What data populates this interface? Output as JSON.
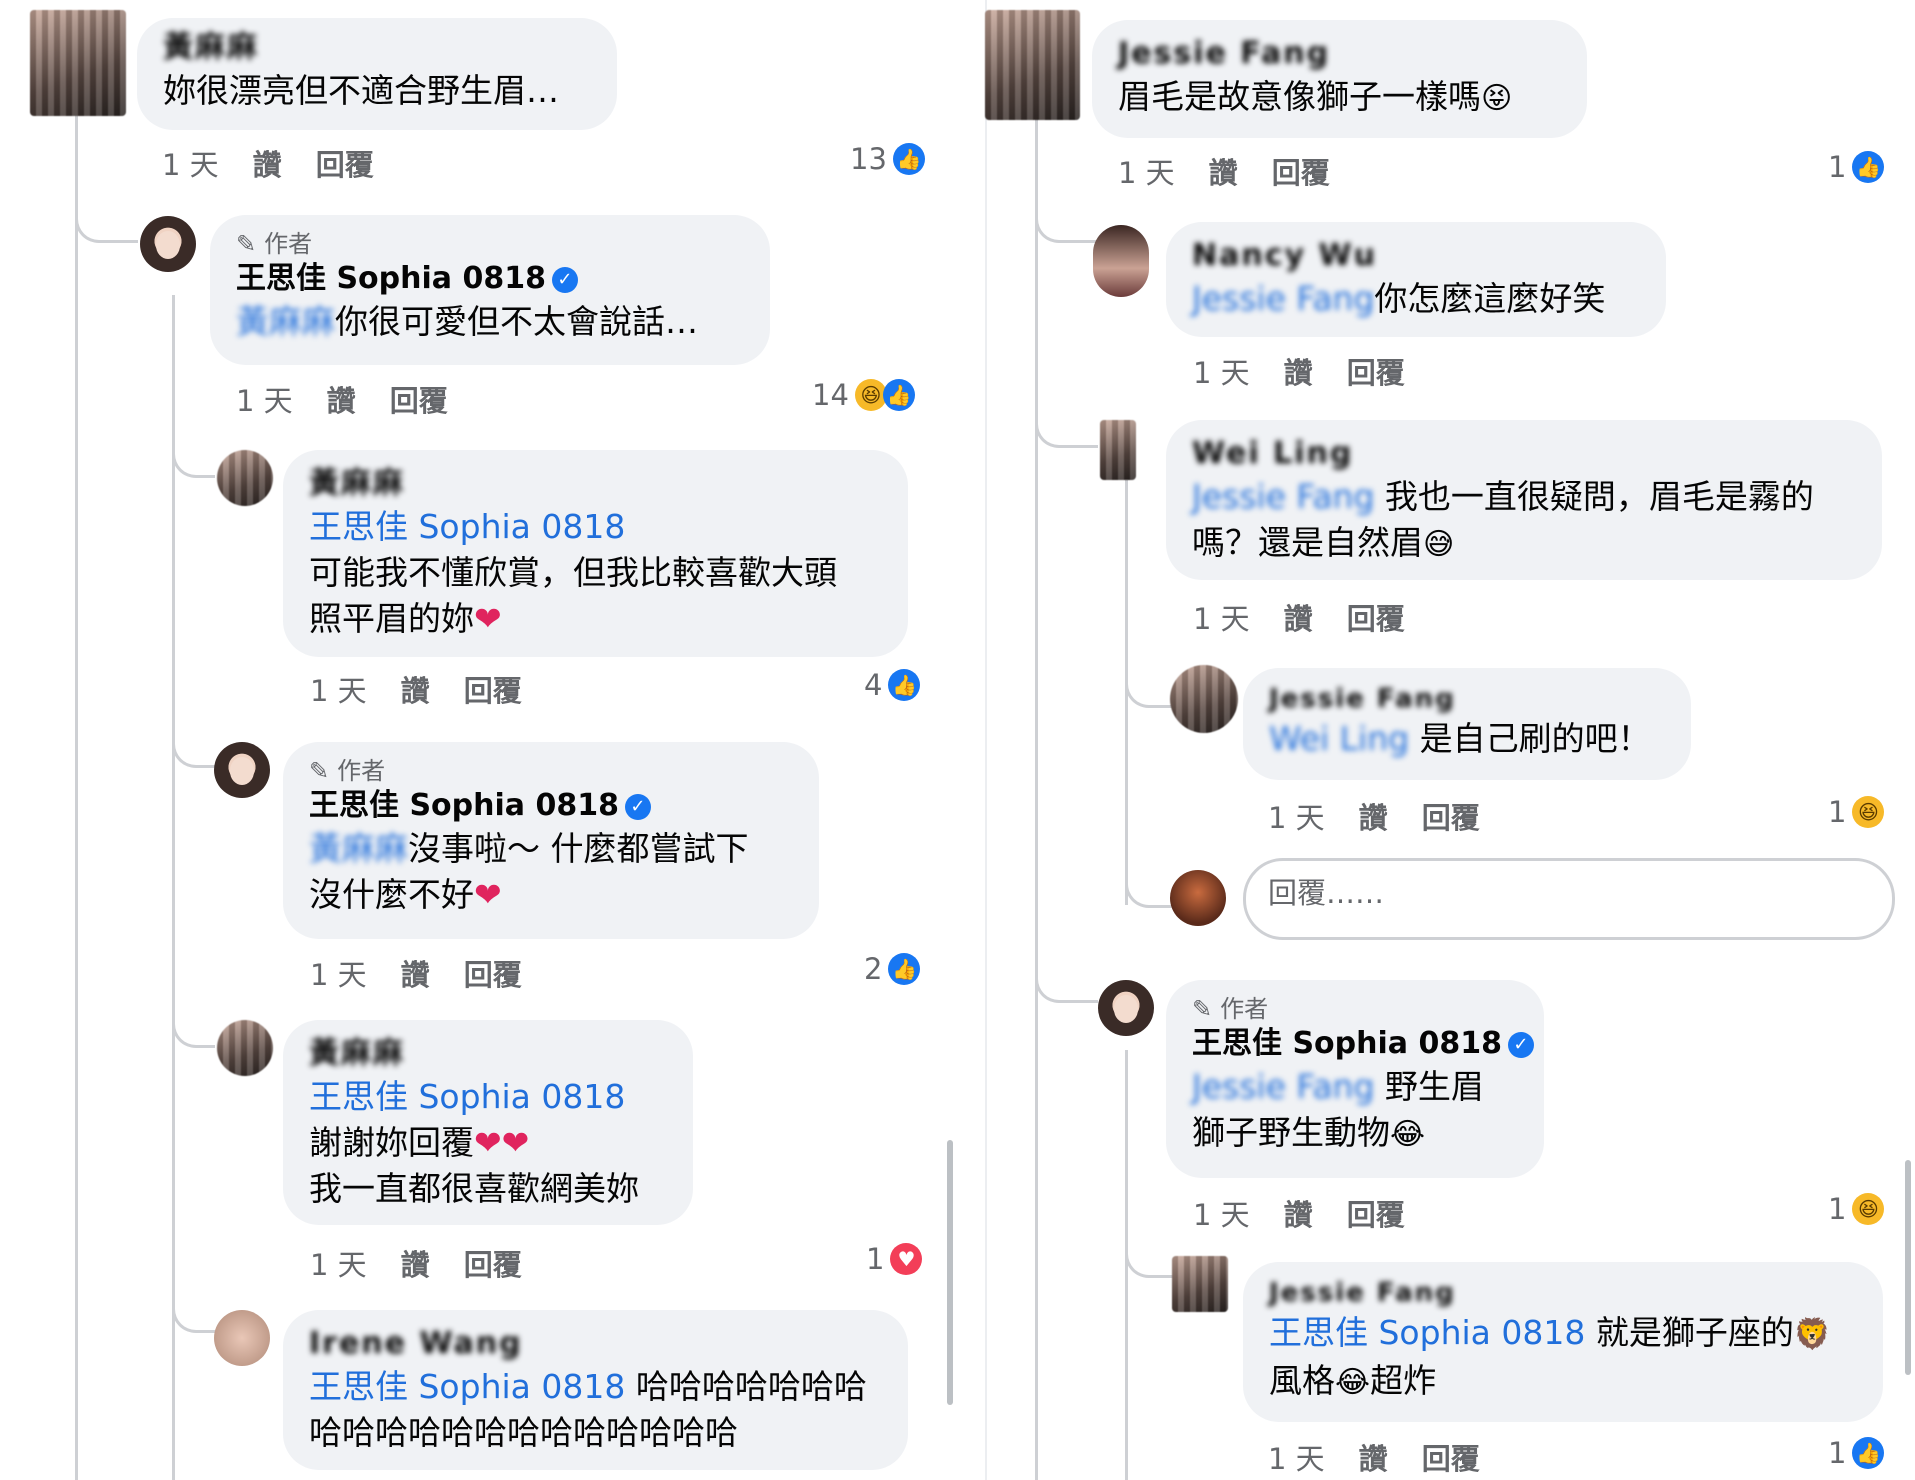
{
  "left": {
    "c1": {
      "name": "黃麻麻",
      "text": "妳很漂亮但不適合野生眉…",
      "time": "1 天",
      "like": "讚",
      "reply": "回覆",
      "count": "13"
    },
    "c2": {
      "author": "作者",
      "name": "王思佳 Sophia 0818",
      "mention": "黃麻麻",
      "text": "你很可愛但不太會說話…",
      "time": "1 天",
      "like": "讚",
      "reply": "回覆",
      "count": "14"
    },
    "c3": {
      "name": "黃麻麻",
      "mention": "王思佳 Sophia 0818",
      "text1": "可能我不懂欣賞，但我比較喜歡大頭",
      "text2": "照平眉的妳",
      "time": "1 天",
      "like": "讚",
      "reply": "回覆",
      "count": "4"
    },
    "c4": {
      "author": "作者",
      "name": "王思佳 Sophia 0818",
      "mention": "黃麻麻",
      "text1": "沒事啦～ 什麼都嘗試下",
      "text2": "沒什麼不好",
      "time": "1 天",
      "like": "讚",
      "reply": "回覆",
      "count": "2"
    },
    "c5": {
      "name": "黃麻麻",
      "mention": "王思佳 Sophia 0818",
      "text1": "謝謝妳回覆",
      "text2": "我一直都很喜歡網美妳",
      "time": "1 天",
      "like": "讚",
      "reply": "回覆",
      "count": "1"
    },
    "c6": {
      "name": "Irene Wang",
      "mention": "王思佳 Sophia 0818",
      "text1": "哈哈哈哈哈哈哈",
      "text2": "哈哈哈哈哈哈哈哈哈哈哈哈哈"
    }
  },
  "right": {
    "c1": {
      "name": "Jessie Fang",
      "text": "眉毛是故意像獅子一樣嗎",
      "time": "1 天",
      "like": "讚",
      "reply": "回覆",
      "count": "1"
    },
    "c2": {
      "name": "Nancy Wu",
      "mention": "Jessie Fang",
      "text": "你怎麼這麼好笑",
      "time": "1 天",
      "like": "讚",
      "reply": "回覆"
    },
    "c3": {
      "name": "Wei Ling",
      "mention": "Jessie Fang",
      "text1": "我也一直很疑問，眉毛是霧的",
      "text2": "嗎？還是自然眉",
      "time": "1 天",
      "like": "讚",
      "reply": "回覆"
    },
    "c4": {
      "name": "Jessie Fang",
      "mention": "Wei Ling",
      "text": "是自己刷的吧！",
      "time": "1 天",
      "like": "讚",
      "reply": "回覆",
      "count": "1"
    },
    "reply_placeholder": "回覆……",
    "c5": {
      "author": "作者",
      "name": "王思佳 Sophia 0818",
      "mention": "Jessie Fang",
      "text1": "野生眉",
      "text2": "獅子野生動物",
      "time": "1 天",
      "like": "讚",
      "reply": "回覆",
      "count": "1"
    },
    "c6": {
      "name": "Jessie Fang",
      "mention": "王思佳 Sophia 0818",
      "text1": "就是獅子座的",
      "text2a": "風格",
      "text2b": "超炸",
      "time": "1 天",
      "like": "讚",
      "reply": "回覆",
      "count": "1"
    }
  },
  "colors": {
    "accent": "#1877f2",
    "mention": "#216fdb",
    "bubble": "#f0f2f5",
    "meta": "#65676b"
  }
}
